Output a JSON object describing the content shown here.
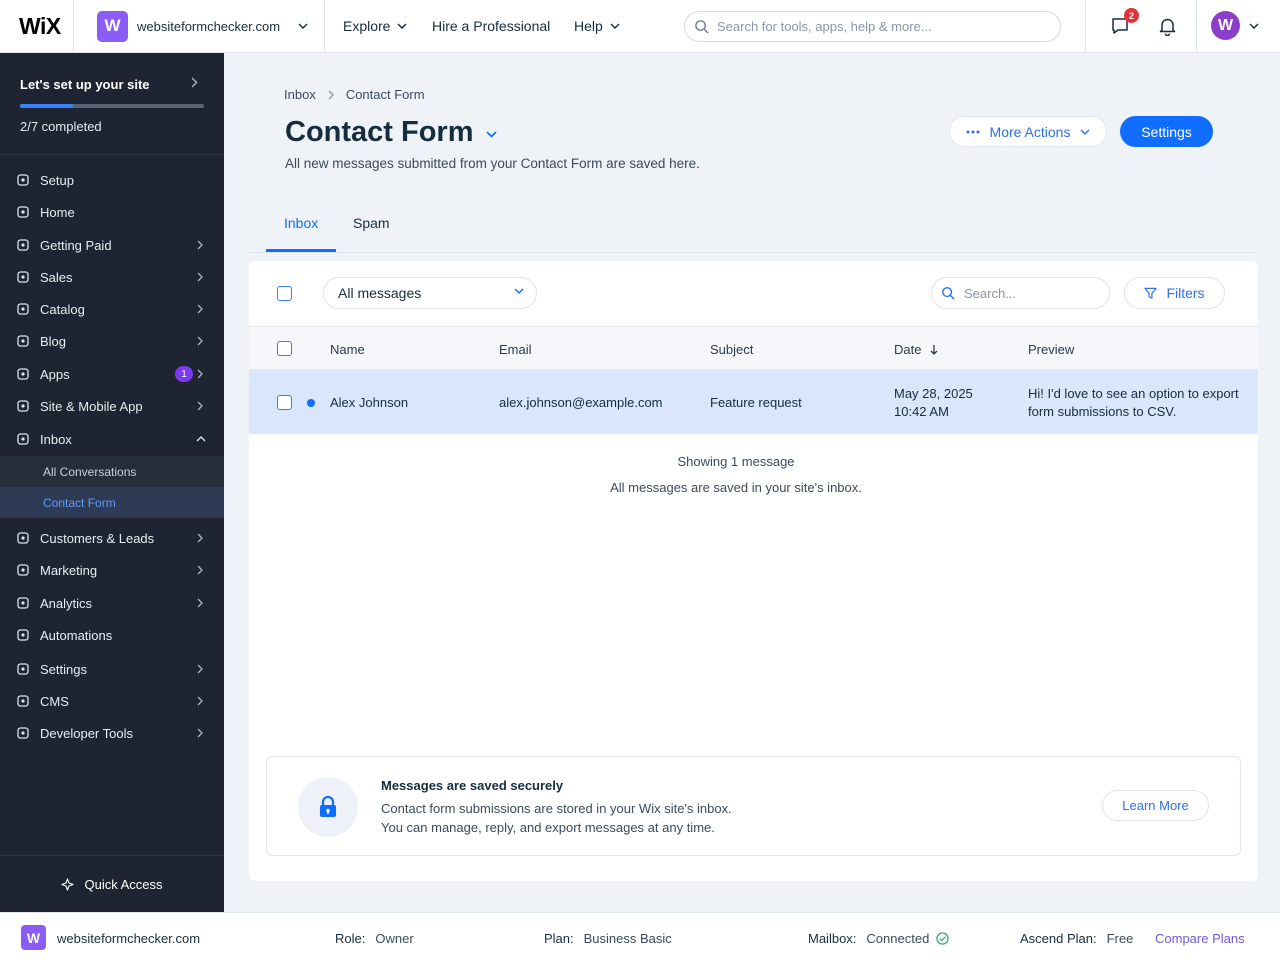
{
  "topbar": {
    "logo": "WiX",
    "site_avatar_letter": "W",
    "site_name": "websiteformchecker.com",
    "nav": [
      "Explore",
      "Hire a Professional",
      "Help"
    ],
    "search_placeholder": "Search for tools, apps, help & more...",
    "messages_badge": "2",
    "user_initial": "W"
  },
  "sidebar": {
    "setup_title": "Let's set up your site",
    "setup_progress": "2/7 completed",
    "setup_progress_fraction": 0.286,
    "items": [
      {
        "label": "Setup",
        "icon": "setup-icon"
      },
      {
        "label": "Home",
        "icon": "home-icon"
      },
      {
        "label": "Getting Paid",
        "icon": "getting-paid-icon"
      },
      {
        "label": "Sales",
        "icon": "sales-icon"
      },
      {
        "label": "Catalog",
        "icon": "catalog-icon"
      },
      {
        "label": "Blog",
        "icon": "blog-icon"
      },
      {
        "label": "Apps",
        "icon": "apps-icon",
        "badge": "1"
      },
      {
        "label": "Site & Mobile App",
        "icon": "site-mobile-icon"
      },
      {
        "label": "Inbox",
        "icon": "inbox-icon"
      },
      {
        "label": "Customers & Leads",
        "icon": "customers-icon"
      },
      {
        "label": "Marketing",
        "icon": "marketing-icon"
      },
      {
        "label": "Analytics",
        "icon": "analytics-icon"
      },
      {
        "label": "Automations",
        "icon": "automations-icon"
      },
      {
        "label": "Settings",
        "icon": "settings-icon"
      },
      {
        "label": "CMS",
        "icon": "cms-icon"
      },
      {
        "label": "Developer Tools",
        "icon": "developer-tools-icon"
      }
    ],
    "inbox_sub": [
      "All Conversations",
      "Contact Form"
    ],
    "quick_access": "Quick Access"
  },
  "main": {
    "breadcrumb": [
      "Inbox",
      "Contact Form"
    ],
    "title": "Contact Form",
    "subtitle": "All new messages submitted from your Contact Form are saved here.",
    "more_actions": "More Actions",
    "settings": "Settings",
    "tabs": [
      "Inbox",
      "Spam"
    ],
    "filter_value": "All messages",
    "search_placeholder": "Search...",
    "filters_label": "Filters",
    "columns": [
      "Name",
      "Email",
      "Subject",
      "Date",
      "Preview"
    ],
    "rows": [
      {
        "name": "Alex Johnson",
        "email": "alex.johnson@example.com",
        "subject": "Feature request",
        "date_line1": "May 28, 2025",
        "date_line2": "10:42 AM",
        "preview_line1": "Hi! I'd love to see an option to export",
        "preview_line2": "form submissions to CSV."
      }
    ],
    "showing": "Showing 1 message",
    "saved_note": "All messages are saved in your site's inbox.",
    "secure": {
      "title": "Messages are saved securely",
      "line1": "Contact form submissions are stored in your Wix site's inbox.",
      "line2": "You can manage, reply, and export messages at any time.",
      "learn_more": "Learn More"
    }
  },
  "footer": {
    "site_avatar_letter": "W",
    "site_name": "websiteformchecker.com",
    "role_label": "Role:",
    "role_value": "Owner",
    "plan_label": "Plan:",
    "plan_value": "Business Basic",
    "mailbox_label": "Mailbox:",
    "mailbox_value": "Connected",
    "ascend_label": "Ascend Plan:",
    "ascend_value": "Free",
    "compare_plans": "Compare Plans"
  },
  "colors": {
    "accent": "#116dff",
    "sidebar_bg": "#1e2431",
    "selected_row": "#d9e6fb",
    "badge_purple": "#7c3aed",
    "notification_red": "#e0333a"
  }
}
